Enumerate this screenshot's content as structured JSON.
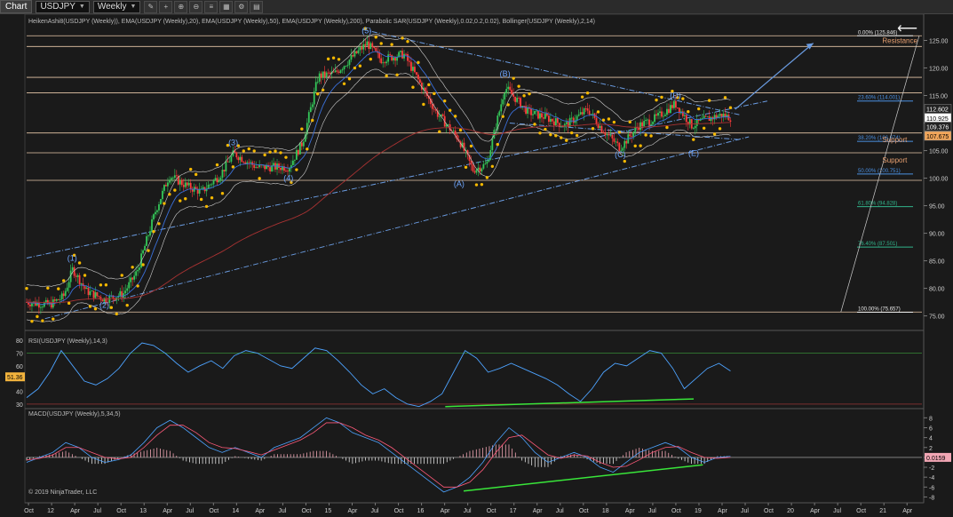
{
  "toolbar": {
    "tab_label": "Chart",
    "instrument": "USDJPY",
    "timeframe": "Weekly",
    "back_icon": "arrow-left-icon"
  },
  "colors": {
    "background": "#1a1a1a",
    "heiken_up": "#34c759",
    "heiken_down": "#ff3b3b",
    "sar": "#f5b800",
    "ema20": "#3a6fd8",
    "ema200": "#a83232",
    "trendline": "#6a9be0",
    "support": "#e8a070",
    "rsi": "#4da3ff",
    "macd_signal": "#ff5a7a",
    "divergence": "#39e63a"
  },
  "chart_data": [
    {
      "type": "candlestick",
      "panel": "price",
      "title": "HeikenAshi8(USDJPY (Weekly)), EMA(USDJPY (Weekly),20), EMA(USDJPY (Weekly),50), EMA(USDJPY (Weekly),200), Parabolic SAR(USDJPY (Weekly),0.02,0.2,0.02), Bollinger(USDJPY (Weekly),2,14)",
      "ylim": [
        73,
        127.5
      ],
      "y_ticks": [
        "125.00",
        "120.00",
        "115.00",
        "110.00",
        "105.00",
        "100.00",
        "95.00",
        "90.00",
        "85.00",
        "80.00",
        "75.00"
      ],
      "x_ticks": [
        "Oct",
        "12",
        "Apr",
        "Jul",
        "Oct",
        "13",
        "Apr",
        "Jul",
        "Oct",
        "14",
        "Apr",
        "Jul",
        "Oct",
        "15",
        "Apr",
        "Jul",
        "Oct",
        "16",
        "Apr",
        "Jul",
        "Oct",
        "17",
        "Apr",
        "Jul",
        "Oct",
        "18",
        "Apr",
        "Jul",
        "Oct",
        "19",
        "Apr",
        "Jul",
        "Oct",
        "20",
        "Apr",
        "Jul",
        "Oct",
        "21",
        "Apr"
      ],
      "x_range": [
        2011.75,
        2021.5
      ],
      "price_path": [
        [
          2011.75,
          77.5
        ],
        [
          2012.0,
          77.0
        ],
        [
          2012.15,
          78.5
        ],
        [
          2012.25,
          83.5
        ],
        [
          2012.4,
          79.5
        ],
        [
          2012.6,
          78.0
        ],
        [
          2012.8,
          79.0
        ],
        [
          2012.95,
          83.0
        ],
        [
          2013.15,
          94.0
        ],
        [
          2013.3,
          100.5
        ],
        [
          2013.5,
          98.5
        ],
        [
          2013.65,
          97.5
        ],
        [
          2013.85,
          100.5
        ],
        [
          2014.0,
          104.5
        ],
        [
          2014.25,
          102.0
        ],
        [
          2014.6,
          102.0
        ],
        [
          2014.75,
          106.5
        ],
        [
          2014.92,
          118.5
        ],
        [
          2015.1,
          119.0
        ],
        [
          2015.45,
          124.5
        ],
        [
          2015.6,
          121.5
        ],
        [
          2015.85,
          122.5
        ],
        [
          2016.0,
          118.0
        ],
        [
          2016.2,
          112.0
        ],
        [
          2016.45,
          107.0
        ],
        [
          2016.6,
          101.5
        ],
        [
          2016.75,
          102.5
        ],
        [
          2016.95,
          116.5
        ],
        [
          2017.2,
          112.0
        ],
        [
          2017.4,
          111.0
        ],
        [
          2017.6,
          109.5
        ],
        [
          2017.85,
          112.5
        ],
        [
          2018.0,
          109.0
        ],
        [
          2018.2,
          105.5
        ],
        [
          2018.4,
          109.5
        ],
        [
          2018.6,
          111.0
        ],
        [
          2018.8,
          113.5
        ],
        [
          2018.98,
          109.5
        ],
        [
          2019.1,
          110.5
        ],
        [
          2019.3,
          111.5
        ],
        [
          2019.4,
          111.0
        ]
      ],
      "wave_labels": [
        {
          "label": "(1)",
          "x": 2012.25,
          "y": 85.0
        },
        {
          "label": "(2)",
          "x": 2012.6,
          "y": 76.5
        },
        {
          "label": "(3)",
          "x": 2014.0,
          "y": 106.0
        },
        {
          "label": "(4)",
          "x": 2014.6,
          "y": 99.5
        },
        {
          "label": "(5)",
          "x": 2015.45,
          "y": 126.3
        },
        {
          "label": "(A)",
          "x": 2016.45,
          "y": 98.5
        },
        {
          "label": "(B)",
          "x": 2016.95,
          "y": 118.5
        },
        {
          "label": "(C)",
          "x": 2018.2,
          "y": 103.8
        },
        {
          "label": "(D)",
          "x": 2018.8,
          "y": 114.5
        },
        {
          "label": "(E)",
          "x": 2019.0,
          "y": 104.0
        }
      ],
      "horizontal_lines": [
        125.85,
        123.9,
        118.3,
        115.5,
        108.2,
        104.6,
        99.6,
        75.7
      ],
      "annotations": [
        {
          "text": "Resistance",
          "x": 2021.05,
          "y": 124.5
        },
        {
          "text": "Support",
          "x": 2021.05,
          "y": 106.5
        },
        {
          "text": "Support",
          "x": 2021.05,
          "y": 102.8
        }
      ],
      "fib_levels": [
        {
          "label": "0.00% (125.846)",
          "y": 125.846
        },
        {
          "label": "23.60% (114.001)",
          "y": 114.001
        },
        {
          "label": "38.20% (106.674)",
          "y": 106.674
        },
        {
          "label": "50.00% (100.751)",
          "y": 100.751
        },
        {
          "label": "61.80% (94.828)",
          "y": 94.828
        },
        {
          "label": "76.40% (87.501)",
          "y": 87.501
        },
        {
          "label": "100.00% (75.657)",
          "y": 75.657
        }
      ],
      "price_markers": [
        {
          "label": "112.602",
          "y": 112.6,
          "style": "dark"
        },
        {
          "label": "110.925",
          "y": 110.925,
          "style": "white"
        },
        {
          "label": "109.376",
          "y": 109.376,
          "style": "dark"
        },
        {
          "label": "107.675",
          "y": 107.675,
          "style": "orange"
        }
      ]
    },
    {
      "type": "line",
      "panel": "rsi",
      "title": "RSI(USDJPY (Weekly),14,3)",
      "ylim": [
        25,
        85
      ],
      "y_ticks": [
        "80",
        "70",
        "60",
        "50",
        "40",
        "30"
      ],
      "current_label": "51.36",
      "series": [
        {
          "values": [
            35,
            42,
            55,
            72,
            60,
            48,
            45,
            50,
            58,
            70,
            78,
            76,
            70,
            62,
            55,
            60,
            64,
            58,
            68,
            72,
            70,
            65,
            60,
            58,
            66,
            74,
            72,
            64,
            55,
            45,
            38,
            42,
            35,
            30,
            28,
            32,
            38,
            55,
            72,
            66,
            55,
            58,
            62,
            58,
            54,
            50,
            45,
            38,
            32,
            42,
            55,
            62,
            60,
            66,
            72,
            70,
            58,
            42,
            50,
            58,
            62,
            56
          ]
        }
      ],
      "divergence": {
        "from": [
          2016.3,
          28
        ],
        "to": [
          2019.0,
          34
        ]
      }
    },
    {
      "type": "bar",
      "panel": "macd",
      "title": "MACD(USDJPY (Weekly),5,34,5)",
      "ylim": [
        -9,
        9.5
      ],
      "y_ticks": [
        "8",
        "6",
        "4",
        "2",
        "0",
        "-2",
        "-4",
        "-6",
        "-8"
      ],
      "current_label": "0.0159",
      "series": [
        {
          "values": [
            -1,
            0,
            1,
            3,
            2,
            0,
            -1,
            -0.5,
            0.5,
            3,
            6,
            7.5,
            6,
            4,
            2,
            1,
            2,
            1,
            0,
            2,
            3,
            4,
            6,
            8,
            7,
            5,
            4,
            3,
            1,
            -1,
            -3,
            -5,
            -7,
            -6,
            -4,
            -1,
            3,
            6,
            4,
            1,
            -1,
            0,
            1,
            0,
            -2,
            -3,
            -1,
            1,
            2,
            3,
            2,
            0,
            -1,
            0,
            0.2
          ]
        },
        {
          "values": [
            -0.5,
            -0.2,
            0.5,
            2,
            2,
            1,
            0,
            -0.3,
            0,
            2,
            4.5,
            6.5,
            6.5,
            5,
            3,
            2,
            1.8,
            1.2,
            0.5,
            1.5,
            2.5,
            3.5,
            5,
            7,
            7,
            6,
            4.5,
            3.5,
            2,
            0,
            -2,
            -4,
            -6,
            -6,
            -5,
            -2.5,
            1,
            4,
            4.5,
            2.5,
            0.5,
            -0.2,
            0.5,
            0.3,
            -1,
            -2,
            -1.8,
            -0.5,
            1,
            2,
            2.2,
            1,
            0,
            -0.2,
            0
          ]
        }
      ],
      "divergence": {
        "from": [
          2016.5,
          -6.8
        ],
        "to": [
          2019.1,
          -1.5
        ]
      }
    }
  ],
  "footer": {
    "copyright": "© 2019 NinjaTrader, LLC"
  }
}
